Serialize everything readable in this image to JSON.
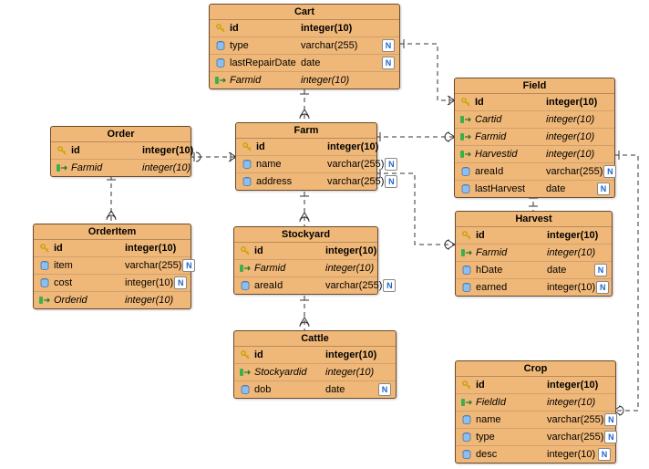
{
  "entities": {
    "cart": {
      "title": "Cart",
      "rows": [
        {
          "icon": "key",
          "name": "id",
          "type": "integer(10)",
          "bold": true,
          "null": false
        },
        {
          "icon": "col",
          "name": "type",
          "type": "varchar(255)",
          "null": true
        },
        {
          "icon": "col",
          "name": "lastRepairDate",
          "type": "date",
          "null": true
        },
        {
          "icon": "fk",
          "name": "Farmid",
          "type": "integer(10)",
          "italic": true,
          "null": false
        }
      ]
    },
    "field": {
      "title": "Field",
      "rows": [
        {
          "icon": "key",
          "name": "Id",
          "type": "integer(10)",
          "bold": true,
          "null": false
        },
        {
          "icon": "fk",
          "name": "Cartid",
          "type": "integer(10)",
          "italic": true,
          "null": false
        },
        {
          "icon": "fk",
          "name": "Farmid",
          "type": "integer(10)",
          "italic": true,
          "null": false
        },
        {
          "icon": "fk",
          "name": "Harvestid",
          "type": "integer(10)",
          "italic": true,
          "null": false
        },
        {
          "icon": "col",
          "name": "areaId",
          "type": "varchar(255)",
          "null": true
        },
        {
          "icon": "col",
          "name": "lastHarvest",
          "type": "date",
          "null": true
        }
      ]
    },
    "order": {
      "title": "Order",
      "rows": [
        {
          "icon": "key",
          "name": "id",
          "type": "integer(10)",
          "bold": true,
          "null": false
        },
        {
          "icon": "fk",
          "name": "Farmid",
          "type": "integer(10)",
          "italic": true,
          "null": false
        }
      ]
    },
    "farm": {
      "title": "Farm",
      "rows": [
        {
          "icon": "key",
          "name": "id",
          "type": "integer(10)",
          "bold": true,
          "null": false
        },
        {
          "icon": "col",
          "name": "name",
          "type": "varchar(255)",
          "null": true
        },
        {
          "icon": "col",
          "name": "address",
          "type": "varchar(255)",
          "null": true
        }
      ]
    },
    "orderitem": {
      "title": "OrderItem",
      "rows": [
        {
          "icon": "key",
          "name": "id",
          "type": "integer(10)",
          "bold": true,
          "null": false
        },
        {
          "icon": "col",
          "name": "item",
          "type": "varchar(255)",
          "null": true
        },
        {
          "icon": "col",
          "name": "cost",
          "type": "integer(10)",
          "null": true
        },
        {
          "icon": "fk",
          "name": "Orderid",
          "type": "integer(10)",
          "italic": true,
          "null": false
        }
      ]
    },
    "stockyard": {
      "title": "Stockyard",
      "rows": [
        {
          "icon": "key",
          "name": "id",
          "type": "integer(10)",
          "bold": true,
          "null": false
        },
        {
          "icon": "fk",
          "name": "Farmid",
          "type": "integer(10)",
          "italic": true,
          "null": false
        },
        {
          "icon": "col",
          "name": "areaId",
          "type": "varchar(255)",
          "null": true
        }
      ]
    },
    "harvest": {
      "title": "Harvest",
      "rows": [
        {
          "icon": "key",
          "name": "id",
          "type": "integer(10)",
          "bold": true,
          "null": false
        },
        {
          "icon": "fk",
          "name": "Farmid",
          "type": "integer(10)",
          "italic": true,
          "null": false
        },
        {
          "icon": "col",
          "name": "hDate",
          "type": "date",
          "null": true
        },
        {
          "icon": "col",
          "name": "earned",
          "type": "integer(10)",
          "null": true
        }
      ]
    },
    "cattle": {
      "title": "Cattle",
      "rows": [
        {
          "icon": "key",
          "name": "id",
          "type": "integer(10)",
          "bold": true,
          "null": false
        },
        {
          "icon": "fk",
          "name": "Stockyardid",
          "type": "integer(10)",
          "italic": true,
          "null": false
        },
        {
          "icon": "col",
          "name": "dob",
          "type": "date",
          "null": true
        }
      ]
    },
    "crop": {
      "title": "Crop",
      "rows": [
        {
          "icon": "key",
          "name": "id",
          "type": "integer(10)",
          "bold": true,
          "null": false
        },
        {
          "icon": "fk",
          "name": "FieldId",
          "type": "integer(10)",
          "italic": true,
          "null": false
        },
        {
          "icon": "col",
          "name": "name",
          "type": "varchar(255)",
          "null": true
        },
        {
          "icon": "col",
          "name": "type",
          "type": "varchar(255)",
          "null": true
        },
        {
          "icon": "col",
          "name": "desc",
          "type": "integer(10)",
          "null": true
        }
      ]
    }
  },
  "null_label": "N"
}
